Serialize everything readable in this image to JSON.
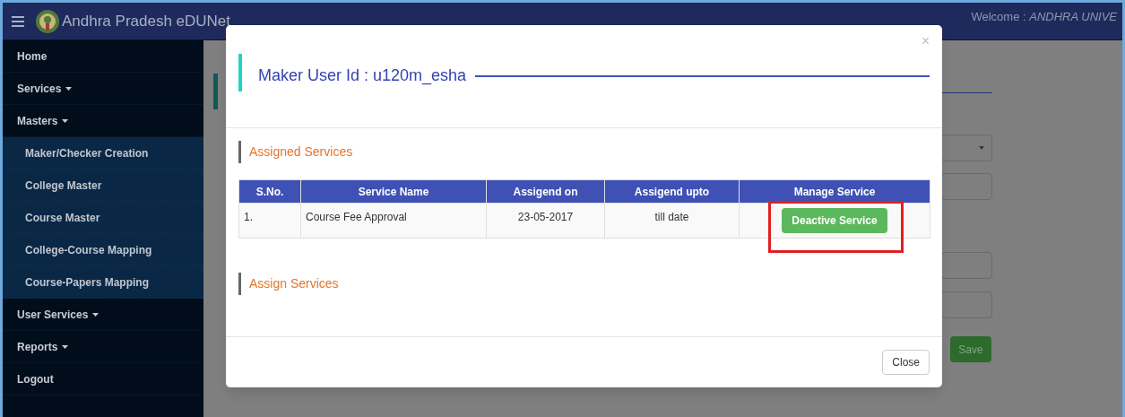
{
  "header": {
    "title": "Andhra Pradesh eDUNet",
    "welcome": "Welcome : *ANDHRA UNIVE*"
  },
  "sidebar": {
    "items": [
      {
        "label": "Home",
        "kind": "link"
      },
      {
        "label": "Services",
        "kind": "dropdown"
      },
      {
        "label": "Masters",
        "kind": "dropdown",
        "children": [
          {
            "label": "Maker/Checker Creation"
          },
          {
            "label": "College Master"
          },
          {
            "label": "Course Master"
          },
          {
            "label": "College-Course Mapping"
          },
          {
            "label": "Course-Papers Mapping"
          }
        ]
      },
      {
        "label": "User Services",
        "kind": "dropdown"
      },
      {
        "label": "Reports",
        "kind": "dropdown"
      },
      {
        "label": "Logout",
        "kind": "link"
      }
    ]
  },
  "background_form": {
    "save_button": "Save"
  },
  "modal": {
    "title": "Maker User Id : u120m_esha",
    "close": "×",
    "sections": [
      {
        "title": "Assigned Services",
        "table": {
          "columns": [
            "S.No.",
            "Service Name",
            "Assigend on",
            "Assigend upto",
            "Manage Service"
          ],
          "rows": [
            {
              "cells": [
                "1.",
                "Course Fee Approval",
                "23-05-2017",
                "till date"
              ],
              "action": "Deactive Service",
              "highlighted": true
            }
          ]
        }
      },
      {
        "title": "Assign Services"
      }
    ],
    "footer_button": "Close"
  }
}
